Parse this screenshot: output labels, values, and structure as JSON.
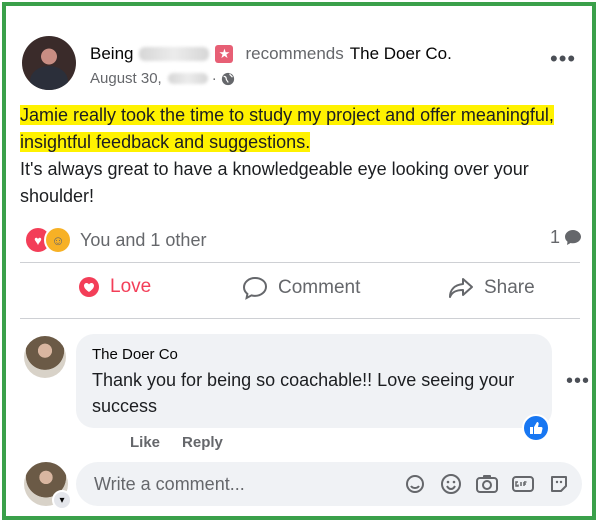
{
  "post": {
    "author_first": "Being",
    "recommends_text": "recommends",
    "page_name": "The Doer Co.",
    "date": "August 30,",
    "text_highlighted": "Jamie really took the time to study my project and offer meaningful, insightful feedback and suggestions.",
    "text_rest": "It's always great to have a knowledgeable eye looking over your shoulder!"
  },
  "reactions": {
    "summary": "You and 1 other",
    "comment_count": "1"
  },
  "actions": {
    "love": "Love",
    "comment": "Comment",
    "share": "Share"
  },
  "comment": {
    "author": "The Doer Co",
    "text": "Thank you for being so coachable!! Love seeing your success",
    "like": "Like",
    "reply": "Reply"
  },
  "composer": {
    "placeholder": "Write a comment..."
  },
  "colors": {
    "frame": "#3aa04a",
    "highlight": "#fff200",
    "love": "#f33e58",
    "like_blue": "#1877f2"
  }
}
